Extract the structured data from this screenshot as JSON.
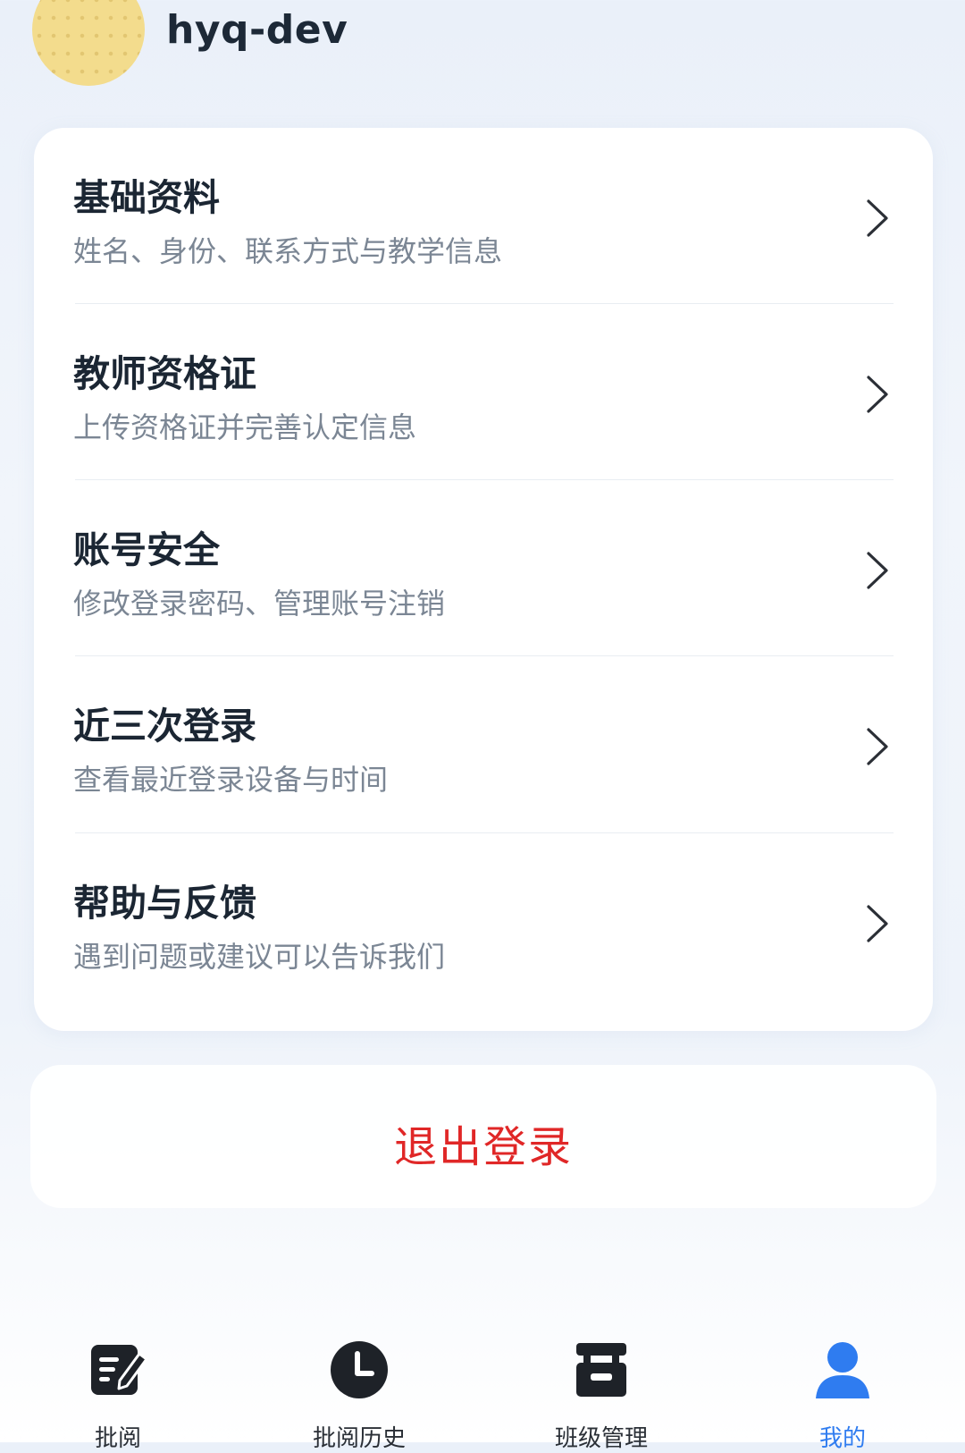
{
  "profile": {
    "username": "hyq-dev",
    "avatar": "avatar-image"
  },
  "menu": {
    "items": [
      {
        "title": "基础资料",
        "subtitle": "姓名、身份、联系方式与教学信息",
        "icon": "chevron-right-icon"
      },
      {
        "title": "教师资格证",
        "subtitle": "上传资格证并完善认定信息",
        "icon": "chevron-right-icon"
      },
      {
        "title": "账号安全",
        "subtitle": "修改登录密码、管理账号注销",
        "icon": "chevron-right-icon"
      },
      {
        "title": "近三次登录",
        "subtitle": "查看最近登录设备与时间",
        "icon": "chevron-right-icon"
      },
      {
        "title": "帮助与反馈",
        "subtitle": "遇到问题或建议可以告诉我们",
        "icon": "chevron-right-icon"
      }
    ]
  },
  "logout": {
    "label": "退出登录",
    "color": "#e02727"
  },
  "tabbar": {
    "active_color": "#2f7cf0",
    "tabs": [
      {
        "label": "批阅",
        "icon": "edit-note-icon",
        "active": false
      },
      {
        "label": "批阅历史",
        "icon": "clock-icon",
        "active": false
      },
      {
        "label": "班级管理",
        "icon": "class-icon",
        "active": false
      },
      {
        "label": "我的",
        "icon": "user-icon",
        "active": true
      }
    ]
  }
}
